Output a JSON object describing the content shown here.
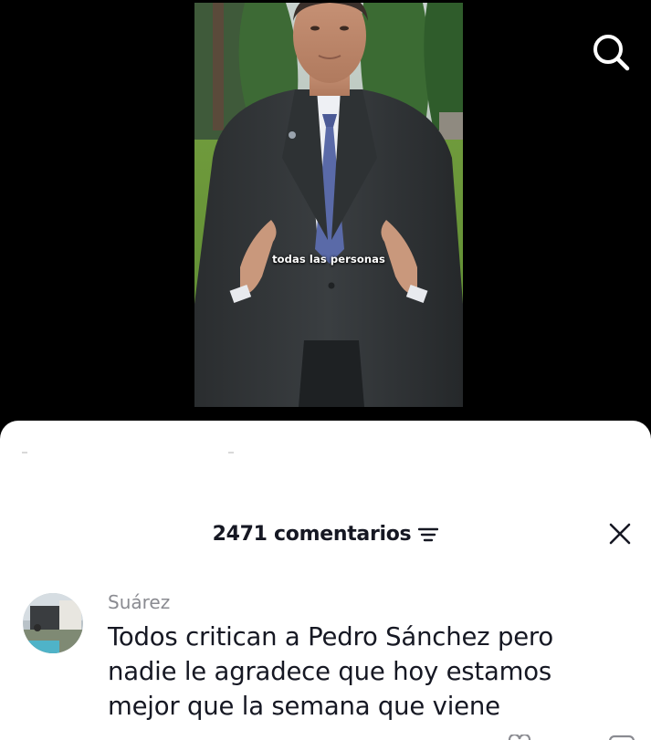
{
  "video": {
    "caption": "todas las personas"
  },
  "icons": {
    "search": "search-icon",
    "filter": "filter-lines-icon",
    "close": "close-icon",
    "like": "heart-icon",
    "reply": "chat-bubble-icon"
  },
  "comments_sheet": {
    "count_label": "2471 comentarios",
    "comments": [
      {
        "author": "Suárez",
        "text": "Todos critican a Pedro Sánchez pero nadie le agradece que hoy estamos mejor que la semana que viene"
      }
    ]
  },
  "colors": {
    "background": "#000000",
    "sheet": "#ffffff",
    "primary_text": "#161823",
    "secondary_text": "#8a8b91",
    "icon_white": "#ffffff"
  }
}
